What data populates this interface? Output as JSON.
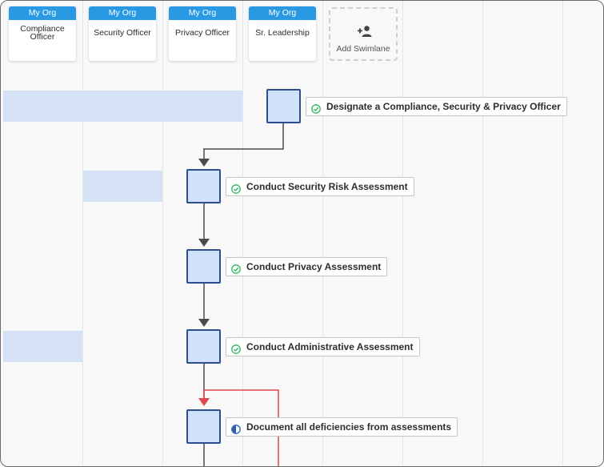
{
  "lanes": [
    {
      "org": "My Org",
      "name": "Compliance Officer"
    },
    {
      "org": "My Org",
      "name": "Security Officer"
    },
    {
      "org": "My Org",
      "name": "Privacy Officer"
    },
    {
      "org": "My Org",
      "name": "Sr. Leadership"
    }
  ],
  "add_swimlane": {
    "label": "Add Swimlane",
    "icon": "add-person-icon"
  },
  "tasks": [
    {
      "label": "Designate a Compliance, Security & Privacy Officer",
      "status": "complete"
    },
    {
      "label": "Conduct Security Risk Assessment",
      "status": "complete"
    },
    {
      "label": "Conduct Privacy Assessment",
      "status": "complete"
    },
    {
      "label": "Conduct Administrative Assessment",
      "status": "complete"
    },
    {
      "label": "Document all deficiencies from assessments",
      "status": "in-progress"
    }
  ],
  "colors": {
    "lane_header": "#2a99e3",
    "node_fill": "#cfe1fb",
    "node_border": "#2d4f8e",
    "lane_highlight": "#d5e2f5",
    "connector": "#4a4a4a",
    "loop_connector": "#e0474c",
    "status_complete": "#2fb760",
    "status_in_progress": "#2d5fb0"
  }
}
